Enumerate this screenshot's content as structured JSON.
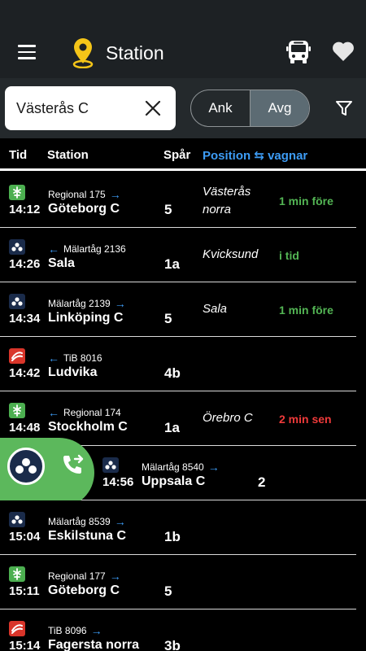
{
  "app": {
    "title": "Station"
  },
  "search": {
    "value": "Västerås C"
  },
  "toggle": {
    "arrivals": "Ank",
    "departures": "Avg"
  },
  "columns": {
    "time": "Tid",
    "station": "Station",
    "track": "Spår",
    "position": "Position ⇆ vagnar"
  },
  "colors": {
    "sj_green": "#4caf50",
    "malartag_navy": "#1a2b4a",
    "tib_red": "#d9352a",
    "accent_blue": "#3d9cf5"
  },
  "rows": [
    {
      "operator": "sj",
      "line": "Regional 175",
      "dir": "right",
      "time": "14:12",
      "dest": "Göteborg C",
      "track": "5",
      "pos1": "Västerås",
      "pos2": "norra",
      "status": "1 min före",
      "status_color": "green"
    },
    {
      "operator": "malartag",
      "line": "Mälartåg 2136",
      "dir": "left",
      "time": "14:26",
      "dest": "Sala",
      "track": "1a",
      "pos1": "Kvicksund",
      "pos2": "",
      "status": "i tid",
      "status_color": "green"
    },
    {
      "operator": "malartag",
      "line": "Mälartåg 2139",
      "dir": "right",
      "time": "14:34",
      "dest": "Linköping C",
      "track": "5",
      "pos1": "Sala",
      "pos2": "",
      "status": "1 min före",
      "status_color": "green"
    },
    {
      "operator": "tib",
      "line": "TiB 8016",
      "dir": "left",
      "time": "14:42",
      "dest": "Ludvika",
      "track": "4b",
      "pos1": "",
      "pos2": "",
      "status": "",
      "status_color": ""
    },
    {
      "operator": "sj",
      "line": "Regional 174",
      "dir": "left",
      "time": "14:48",
      "dest": "Stockholm C",
      "track": "1a",
      "pos1": "Örebro C",
      "pos2": "",
      "status": "2 min sen",
      "status_color": "red"
    },
    {
      "operator": "malartag",
      "line": "Mälartåg 8540",
      "dir": "right",
      "time": "14:56",
      "dest": "Uppsala C",
      "track": "2",
      "pos1": "",
      "pos2": "",
      "status": "",
      "status_color": ""
    },
    {
      "operator": "malartag",
      "line": "Mälartåg 8539",
      "dir": "right",
      "time": "15:04",
      "dest": "Eskilstuna C",
      "track": "1b",
      "pos1": "",
      "pos2": "",
      "status": "",
      "status_color": ""
    },
    {
      "operator": "sj",
      "line": "Regional 177",
      "dir": "right",
      "time": "15:11",
      "dest": "Göteborg C",
      "track": "5",
      "pos1": "",
      "pos2": "",
      "status": "",
      "status_color": ""
    },
    {
      "operator": "tib",
      "line": "TiB 8096",
      "dir": "right",
      "time": "15:14",
      "dest": "Fagersta norra",
      "track": "3b",
      "pos1": "",
      "pos2": "",
      "status": "",
      "status_color": ""
    }
  ]
}
